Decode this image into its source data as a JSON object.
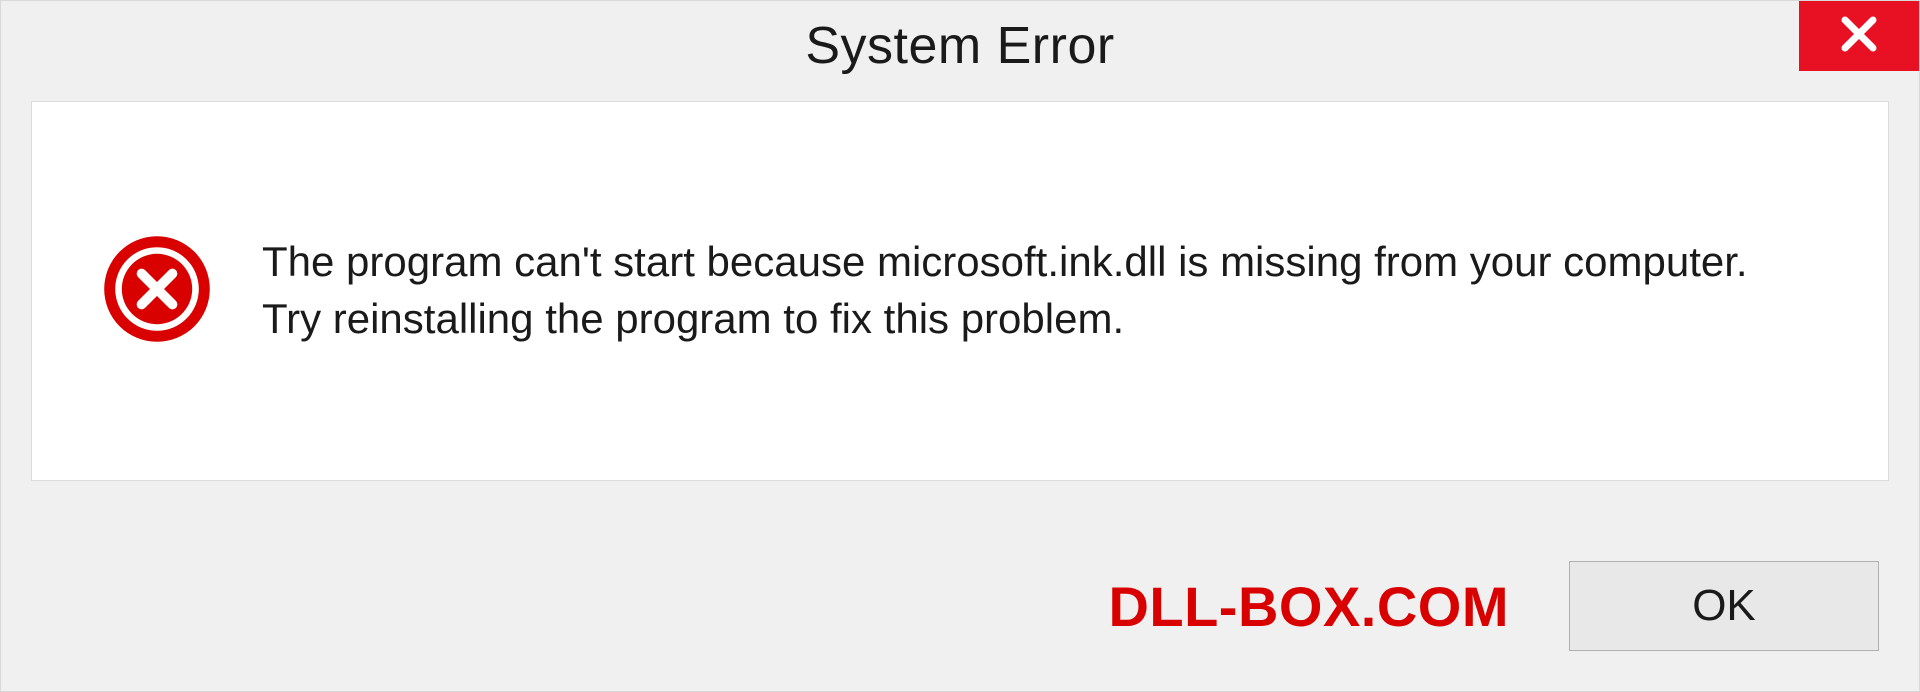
{
  "dialog": {
    "title": "System Error",
    "message": "The program can't start because microsoft.ink.dll is missing from your computer. Try reinstalling the program to fix this problem.",
    "ok_label": "OK"
  },
  "watermark": "DLL-BOX.COM"
}
